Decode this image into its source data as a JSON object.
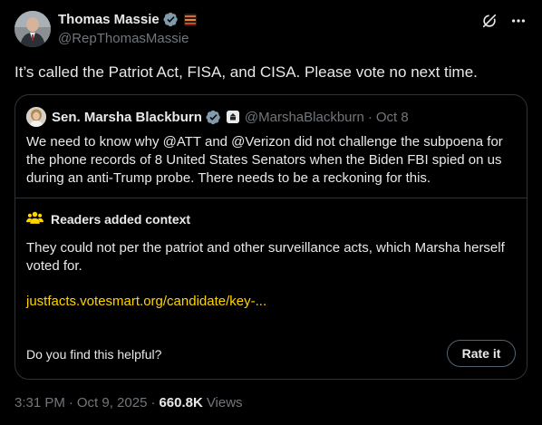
{
  "author": {
    "name": "Thomas Massie",
    "handle": "@RepThomasMassie"
  },
  "tweet": {
    "text": "It’s called the Patriot Act, FISA, and CISA. Please vote no next time."
  },
  "quoted": {
    "name": "Sen. Marsha Blackburn",
    "handle": "@MarshaBlackburn",
    "separator": "·",
    "date": "Oct 8",
    "text": "We need to know why @ATT and @Verizon did not challenge the subpoena for the phone records of 8 United States Senators when the Biden FBI spied on us during an anti-Trump probe. There needs to be a reckoning for this."
  },
  "context": {
    "title": "Readers added context",
    "body": "They could not per the patriot and other surveillance acts, which Marsha herself voted for.",
    "link": "justfacts.votesmart.org/candidate/key-...",
    "helpful_question": "Do you find this helpful?",
    "rate_label": "Rate it"
  },
  "meta": {
    "time": "3:31 PM",
    "sep1": "·",
    "date": "Oct 9, 2025",
    "sep2": "·",
    "views_count": "660.8K",
    "views_label": "Views"
  },
  "colors": {
    "background": "#000000",
    "text": "#e7e9ea",
    "secondary": "#71767b",
    "border": "#2f3336",
    "link_yellow": "#ffd400",
    "verified_gray": "#829aab"
  },
  "icons": [
    "verified-badge-icon",
    "flag-badge-icon",
    "grok-icon",
    "more-icon",
    "government-badge-icon",
    "readers-context-icon"
  ]
}
